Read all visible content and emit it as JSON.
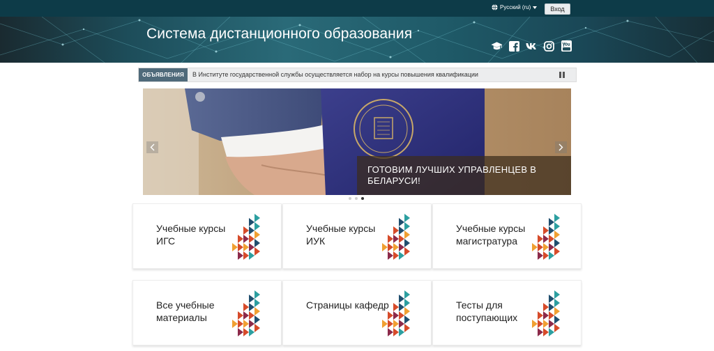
{
  "topbar": {
    "language": "Русский (ru)",
    "login_label": "Вход"
  },
  "header": {
    "title": "Система дистанционного образования",
    "social_icons": [
      "graduation-cap-icon",
      "facebook-icon",
      "vk-icon",
      "instagram-icon",
      "youtube-icon"
    ]
  },
  "announcement": {
    "label": "ОБЪЯВЛЕНИЯ",
    "text": "В Институте государственной службы осуществляется набор на курсы повышения квалификации"
  },
  "slider": {
    "caption": "ГОТОВИМ ЛУЧШИХ УПРАВЛЕНЦЕВ В БЕЛАРУСИ!",
    "slide_count": 3,
    "active_slide": 3
  },
  "tiles": [
    {
      "label": "Учебные курсы ИГС"
    },
    {
      "label": "Учебные курсы ИУК"
    },
    {
      "label": "Учебные курсы магистратура"
    },
    {
      "label": "Все учебные материалы"
    },
    {
      "label": "Страницы кафедр"
    },
    {
      "label": "Тесты для поступающих"
    }
  ],
  "colors": {
    "topbar": "#0d3b48",
    "announcement_label": "#4f6a7a",
    "tile_art": [
      "#2c9fa0",
      "#1f4e6e",
      "#d64b2a",
      "#f0a032",
      "#8c2a4a"
    ]
  }
}
